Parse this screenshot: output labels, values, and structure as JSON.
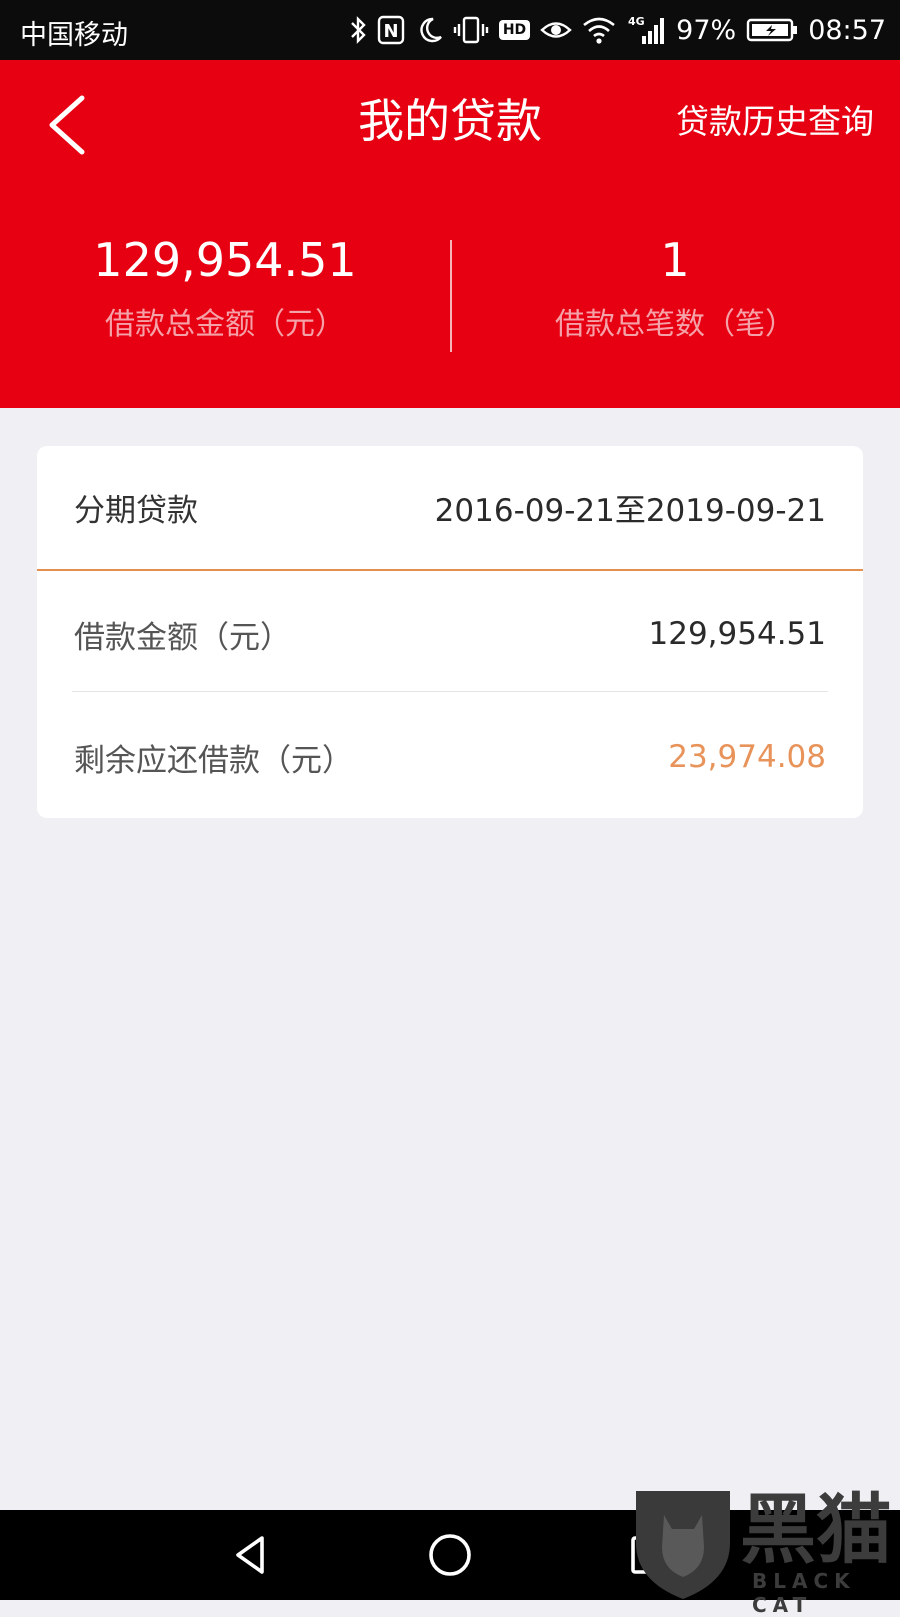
{
  "status_bar": {
    "carrier": "中国移动",
    "signal_type": "4G",
    "battery": "97%",
    "time": "08:57",
    "hd_label": "HD",
    "nfc_label": "N"
  },
  "header": {
    "title": "我的贷款",
    "history_link": "贷款历史查询",
    "total_amount": "129,954.51",
    "total_amount_label": "借款总金额（元）",
    "total_count": "1",
    "total_count_label": "借款总笔数（笔）",
    "bg_color": "#e60012"
  },
  "loan_card": {
    "type": "分期贷款",
    "period": "2016-09-21至2019-09-21",
    "amount_label": "借款金额（元）",
    "amount": "129,954.51",
    "remaining_label": "剩余应还借款（元）",
    "remaining": "23,974.08",
    "remaining_color": "#e8935a"
  },
  "watermark": {
    "text": "黑猫",
    "sub": "BLACK CAT"
  }
}
